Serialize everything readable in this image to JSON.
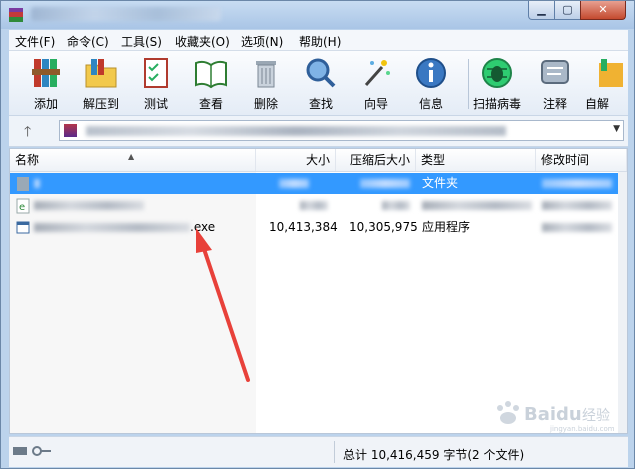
{
  "menu": [
    "文件(F)",
    "命令(C)",
    "工具(S)",
    "收藏夹(O)",
    "选项(N)",
    "帮助(H)"
  ],
  "toolbar": [
    "添加",
    "解压到",
    "测试",
    "查看",
    "删除",
    "查找",
    "向导",
    "信息",
    "扫描病毒",
    "注释",
    "自解"
  ],
  "columns": {
    "name": "名称",
    "size": "大小",
    "packed": "压缩后大小",
    "type": "类型",
    "modified": "修改时间"
  },
  "rows": [
    {
      "type": "文件夹",
      "selected": true
    },
    {
      "type": "",
      "selected": false
    },
    {
      "name_suffix": ".exe",
      "size": "10,413,384",
      "packed": "10,305,975",
      "type": "应用程序",
      "selected": false
    }
  ],
  "status": {
    "text": "总计 10,416,459 字节(2 个文件)"
  },
  "watermark": {
    "brand": "Baidu",
    "label": "经验",
    "sub": "jingyan.baidu.com"
  },
  "colors": {
    "selection": "#3399ff",
    "arrow": "#e8413a"
  }
}
